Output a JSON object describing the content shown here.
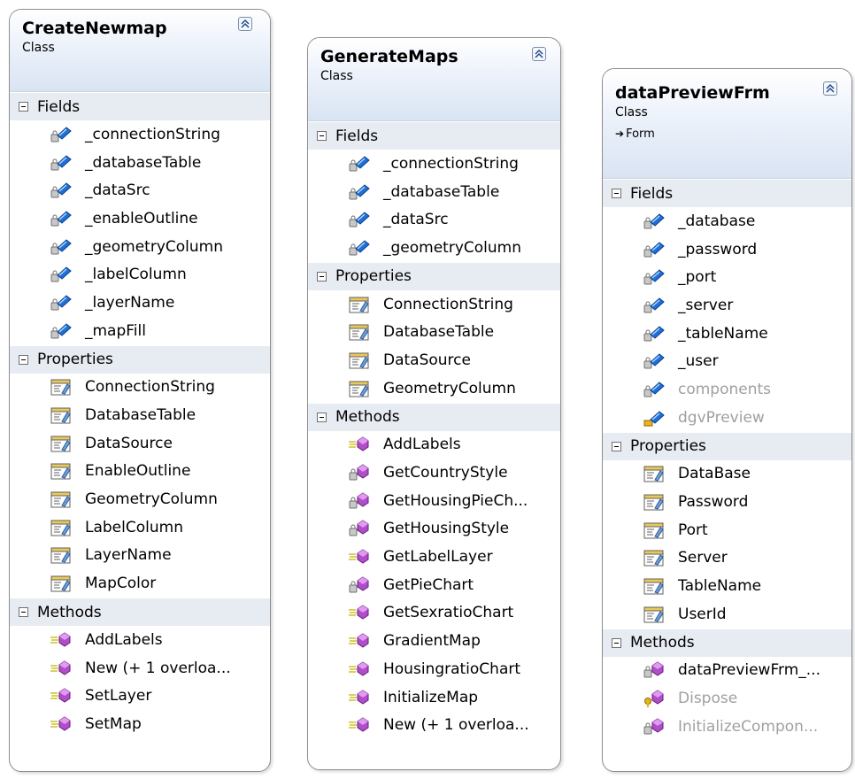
{
  "section_titles": {
    "fields": "Fields",
    "properties": "Properties",
    "methods": "Methods"
  },
  "classes": [
    {
      "name": "CreateNewmap",
      "kind": "Class",
      "base": "",
      "fields": [
        "_connectionString",
        "_databaseTable",
        "_dataSrc",
        "_enableOutline",
        "_geometryColumn",
        "_labelColumn",
        "_layerName",
        "_mapFill"
      ],
      "properties": [
        "ConnectionString",
        "DatabaseTable",
        "DataSource",
        "EnableOutline",
        "GeometryColumn",
        "LabelColumn",
        "LayerName",
        "MapColor"
      ],
      "methods": [
        "AddLabels",
        "New (+ 1 overloa...",
        "SetLayer",
        "SetMap"
      ]
    },
    {
      "name": "GenerateMaps",
      "kind": "Class",
      "base": "",
      "fields": [
        "_connectionString",
        "_databaseTable",
        "_dataSrc",
        "_geometryColumn"
      ],
      "properties": [
        "ConnectionString",
        "DatabaseTable",
        "DataSource",
        "GeometryColumn"
      ],
      "methods": [
        "AddLabels",
        "GetCountryStyle",
        "GetHousingPieCh...",
        "GetHousingStyle",
        "GetLabelLayer",
        "GetPieChart",
        "GetSexratioChart",
        "GradientMap",
        "HousingratioChart",
        "InitializeMap",
        "New (+ 1 overloa..."
      ]
    },
    {
      "name": "dataPreviewFrm",
      "kind": "Class",
      "base": "Form",
      "fields": [
        "_database",
        "_password",
        "_port",
        "_server",
        "_tableName",
        "_user",
        "components",
        "dgvPreview"
      ],
      "properties": [
        "DataBase",
        "Password",
        "Port",
        "Server",
        "TableName",
        "UserId"
      ],
      "methods": [
        "dataPreviewFrm_...",
        "Dispose",
        "InitializeCompon..."
      ]
    }
  ]
}
